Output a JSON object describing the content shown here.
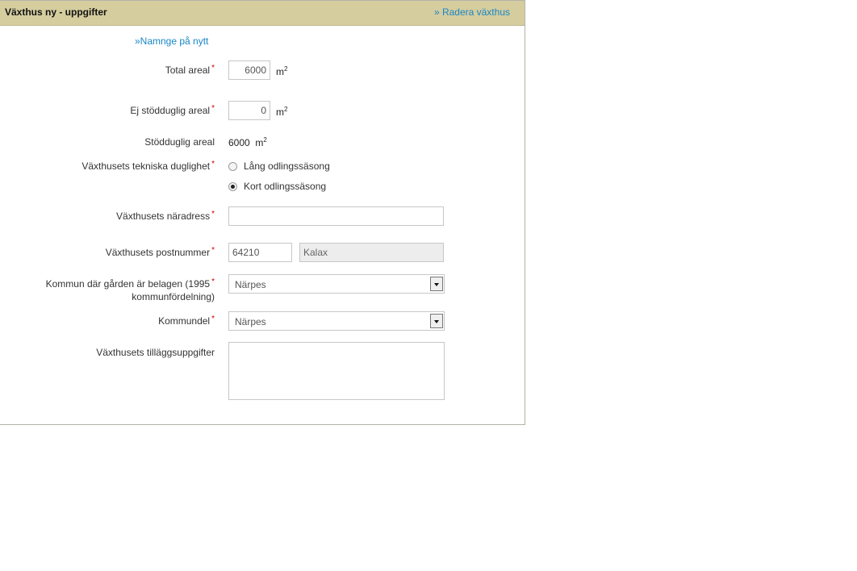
{
  "header": {
    "title": "Växthus ny - uppgifter",
    "delete_link": "» Radera växthus"
  },
  "rename_link": "»Namnge på nytt",
  "form": {
    "total_area": {
      "label": "Total areal",
      "required_mark": "*",
      "value": "6000",
      "unit": "m",
      "unit_sup": "2"
    },
    "non_support_area": {
      "label": "Ej stödduglig areal",
      "required_mark": "*",
      "value": "0",
      "unit": "m",
      "unit_sup": "2"
    },
    "support_area": {
      "label": "Stödduglig areal",
      "value": "6000",
      "unit": "m",
      "unit_sup": "2"
    },
    "technical": {
      "label": "Växthusets tekniska duglighet",
      "required_mark": "*",
      "options": [
        {
          "label": "Lång odlingssäsong",
          "checked": false
        },
        {
          "label": "Kort odlingssäsong",
          "checked": true
        }
      ]
    },
    "address": {
      "label": "Växthusets näradress",
      "required_mark": "*",
      "value": ""
    },
    "postal": {
      "label": "Växthusets postnummer",
      "required_mark": "*",
      "value": "64210",
      "city": "Kalax"
    },
    "municipality": {
      "label_line1": "Kommun där gården är belagen (1995",
      "label_line2": "kommunfördelning)",
      "required_mark": "*",
      "value": "Närpes"
    },
    "municipal_part": {
      "label": "Kommundel",
      "required_mark": "*",
      "value": "Närpes"
    },
    "extra_info": {
      "label": "Växthusets tilläggsuppgifter",
      "value": ""
    }
  },
  "colors": {
    "header_bg": "#d5cd9e",
    "link": "#1a86c6",
    "required": "#cc0000"
  }
}
